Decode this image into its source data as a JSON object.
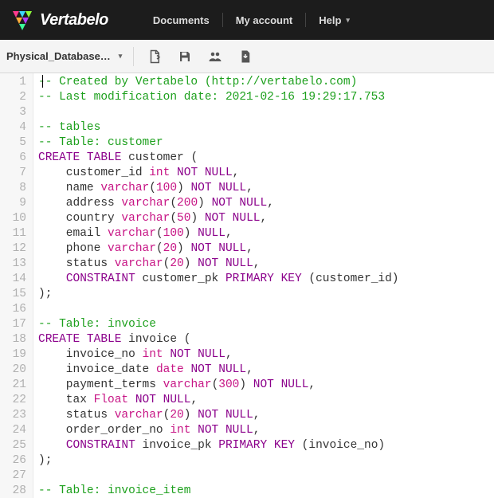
{
  "brand": "Vertabelo",
  "nav": {
    "documents": "Documents",
    "my_account": "My account",
    "help": "Help"
  },
  "toolbar": {
    "document_name": "Physical_Database…"
  },
  "code_lines": [
    [
      [
        "c-comment",
        "-- Created by Vertabelo (http://vertabelo.com)"
      ]
    ],
    [
      [
        "c-comment",
        "-- Last modification date: 2021-02-16 19:29:17.753"
      ]
    ],
    [],
    [
      [
        "c-comment",
        "-- tables"
      ]
    ],
    [
      [
        "c-comment",
        "-- Table: customer"
      ]
    ],
    [
      [
        "c-keyword",
        "CREATE"
      ],
      [
        "",
        ""
      ],
      [
        "c-keyword",
        "TABLE"
      ],
      [
        "",
        " customer ("
      ]
    ],
    [
      [
        "",
        "    customer_id "
      ],
      [
        "c-type",
        "int"
      ],
      [
        "",
        " "
      ],
      [
        "c-keyword",
        "NOT"
      ],
      [
        "",
        " "
      ],
      [
        "c-keyword",
        "NULL"
      ],
      [
        "",
        ","
      ]
    ],
    [
      [
        "",
        "    name "
      ],
      [
        "c-type",
        "varchar"
      ],
      [
        "",
        "("
      ],
      [
        "c-type",
        "100"
      ],
      [
        "",
        ") "
      ],
      [
        "c-keyword",
        "NOT"
      ],
      [
        "",
        " "
      ],
      [
        "c-keyword",
        "NULL"
      ],
      [
        "",
        ","
      ]
    ],
    [
      [
        "",
        "    address "
      ],
      [
        "c-type",
        "varchar"
      ],
      [
        "",
        "("
      ],
      [
        "c-type",
        "200"
      ],
      [
        "",
        ") "
      ],
      [
        "c-keyword",
        "NOT"
      ],
      [
        "",
        " "
      ],
      [
        "c-keyword",
        "NULL"
      ],
      [
        "",
        ","
      ]
    ],
    [
      [
        "",
        "    country "
      ],
      [
        "c-type",
        "varchar"
      ],
      [
        "",
        "("
      ],
      [
        "c-type",
        "50"
      ],
      [
        "",
        ") "
      ],
      [
        "c-keyword",
        "NOT"
      ],
      [
        "",
        " "
      ],
      [
        "c-keyword",
        "NULL"
      ],
      [
        "",
        ","
      ]
    ],
    [
      [
        "",
        "    email "
      ],
      [
        "c-type",
        "varchar"
      ],
      [
        "",
        "("
      ],
      [
        "c-type",
        "100"
      ],
      [
        "",
        ") "
      ],
      [
        "c-keyword",
        "NULL"
      ],
      [
        "",
        ","
      ]
    ],
    [
      [
        "",
        "    phone "
      ],
      [
        "c-type",
        "varchar"
      ],
      [
        "",
        "("
      ],
      [
        "c-type",
        "20"
      ],
      [
        "",
        ") "
      ],
      [
        "c-keyword",
        "NOT"
      ],
      [
        "",
        " "
      ],
      [
        "c-keyword",
        "NULL"
      ],
      [
        "",
        ","
      ]
    ],
    [
      [
        "",
        "    status "
      ],
      [
        "c-type",
        "varchar"
      ],
      [
        "",
        "("
      ],
      [
        "c-type",
        "20"
      ],
      [
        "",
        ") "
      ],
      [
        "c-keyword",
        "NOT"
      ],
      [
        "",
        " "
      ],
      [
        "c-keyword",
        "NULL"
      ],
      [
        "",
        ","
      ]
    ],
    [
      [
        "",
        "    "
      ],
      [
        "c-keyword",
        "CONSTRAINT"
      ],
      [
        "",
        " customer_pk "
      ],
      [
        "c-keyword",
        "PRIMARY"
      ],
      [
        "",
        " "
      ],
      [
        "c-keyword",
        "KEY"
      ],
      [
        "",
        " (customer_id)"
      ]
    ],
    [
      [
        "",
        ");"
      ]
    ],
    [],
    [
      [
        "c-comment",
        "-- Table: invoice"
      ]
    ],
    [
      [
        "c-keyword",
        "CREATE"
      ],
      [
        "",
        ""
      ],
      [
        "c-keyword",
        "TABLE"
      ],
      [
        "",
        " invoice ("
      ]
    ],
    [
      [
        "",
        "    invoice_no "
      ],
      [
        "c-type",
        "int"
      ],
      [
        "",
        " "
      ],
      [
        "c-keyword",
        "NOT"
      ],
      [
        "",
        " "
      ],
      [
        "c-keyword",
        "NULL"
      ],
      [
        "",
        ","
      ]
    ],
    [
      [
        "",
        "    invoice_date "
      ],
      [
        "c-type",
        "date"
      ],
      [
        "",
        " "
      ],
      [
        "c-keyword",
        "NOT"
      ],
      [
        "",
        " "
      ],
      [
        "c-keyword",
        "NULL"
      ],
      [
        "",
        ","
      ]
    ],
    [
      [
        "",
        "    payment_terms "
      ],
      [
        "c-type",
        "varchar"
      ],
      [
        "",
        "("
      ],
      [
        "c-type",
        "300"
      ],
      [
        "",
        ") "
      ],
      [
        "c-keyword",
        "NOT"
      ],
      [
        "",
        " "
      ],
      [
        "c-keyword",
        "NULL"
      ],
      [
        "",
        ","
      ]
    ],
    [
      [
        "",
        "    tax "
      ],
      [
        "c-type",
        "Float"
      ],
      [
        "",
        " "
      ],
      [
        "c-keyword",
        "NOT"
      ],
      [
        "",
        " "
      ],
      [
        "c-keyword",
        "NULL"
      ],
      [
        "",
        ","
      ]
    ],
    [
      [
        "",
        "    status "
      ],
      [
        "c-type",
        "varchar"
      ],
      [
        "",
        "("
      ],
      [
        "c-type",
        "20"
      ],
      [
        "",
        ") "
      ],
      [
        "c-keyword",
        "NOT"
      ],
      [
        "",
        " "
      ],
      [
        "c-keyword",
        "NULL"
      ],
      [
        "",
        ","
      ]
    ],
    [
      [
        "",
        "    order_order_no "
      ],
      [
        "c-type",
        "int"
      ],
      [
        "",
        " "
      ],
      [
        "c-keyword",
        "NOT"
      ],
      [
        "",
        " "
      ],
      [
        "c-keyword",
        "NULL"
      ],
      [
        "",
        ","
      ]
    ],
    [
      [
        "",
        "    "
      ],
      [
        "c-keyword",
        "CONSTRAINT"
      ],
      [
        "",
        " invoice_pk "
      ],
      [
        "c-keyword",
        "PRIMARY"
      ],
      [
        "",
        " "
      ],
      [
        "c-keyword",
        "KEY"
      ],
      [
        "",
        " (invoice_no)"
      ]
    ],
    [
      [
        "",
        ");"
      ]
    ],
    [],
    [
      [
        "c-comment",
        "-- Table: invoice_item"
      ]
    ]
  ]
}
